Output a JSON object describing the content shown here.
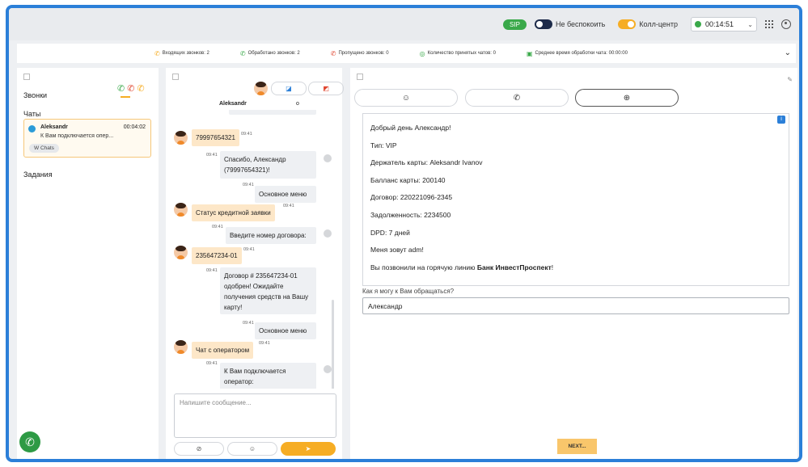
{
  "topbar": {
    "sip_label": "SIP",
    "dnd_label": "Не беспокоить",
    "callcenter_label": "Колл-центр",
    "timer": "00:14:51"
  },
  "stats": [
    {
      "icon": "incoming-call-icon",
      "label": "Входящих звонков: 2"
    },
    {
      "icon": "processed-call-icon",
      "label": "Обработано звонков: 2"
    },
    {
      "icon": "missed-call-icon",
      "label": "Пропущено звонков: 0"
    },
    {
      "icon": "accepted-chats-icon",
      "label": "Количество принятых чатов: 0"
    },
    {
      "icon": "avg-time-icon",
      "label": "Среднее время обработки чата: 00:00:00"
    }
  ],
  "sidebar": {
    "calls_label": "Звонки",
    "chats_label": "Чаты",
    "tasks_label": "Задания",
    "chat": {
      "name": "Aleksandr",
      "time": "00:04:02",
      "preview": "К Вам подключается опер...",
      "channel": "W Chats"
    }
  },
  "chat": {
    "contact_name": "Aleksandr",
    "contact_extra": "o",
    "messages": [
      {
        "dir": "in",
        "text": "79997654321",
        "time": "09:41"
      },
      {
        "dir": "out",
        "text": "Спасибо, Александр (79997654321)!",
        "time": "09:41"
      },
      {
        "dir": "out",
        "text": "Основное меню",
        "time": "09:41"
      },
      {
        "dir": "in",
        "text": "Статус кредитной заявки",
        "time": "09:41"
      },
      {
        "dir": "out",
        "text": "Введите номер договора:",
        "time": "09:41"
      },
      {
        "dir": "in",
        "text": "235647234-01",
        "time": "09:41"
      },
      {
        "dir": "out",
        "text": "Договор # 235647234-01 одобрен! Ожидайте получения средств на Вашу карту!",
        "time": "09:41"
      },
      {
        "dir": "out",
        "text": "Основное меню",
        "time": "09:41"
      },
      {
        "dir": "in",
        "text": "Чат с оператором",
        "time": "09:41"
      },
      {
        "dir": "out",
        "text": "К Вам подключается оператор:",
        "time": "09:41"
      }
    ],
    "composer_placeholder": "Напишите сообщение..."
  },
  "script": {
    "lines": [
      "Добрый день Александр!",
      "Тип: VIP",
      "Держатель карты: Aleksandr Ivanov",
      "Балланс карты: 200140",
      "Договор: 220221096-2345",
      "Задолженность: 2234500",
      "DPD: 7 дней",
      "Меня зовут adm!"
    ],
    "last_line_prefix": "Вы позвонили на горячую линию ",
    "bank_name": "Банк ИнвестПроспект",
    "last_line_suffix": "!",
    "question": "Как я могу к Вам обращаться?",
    "answer": "Александр",
    "next_label": "NEXT..."
  },
  "colors": {
    "accent": "#f6ad24",
    "green": "#3aa94a",
    "blue": "#2b7fd8"
  }
}
